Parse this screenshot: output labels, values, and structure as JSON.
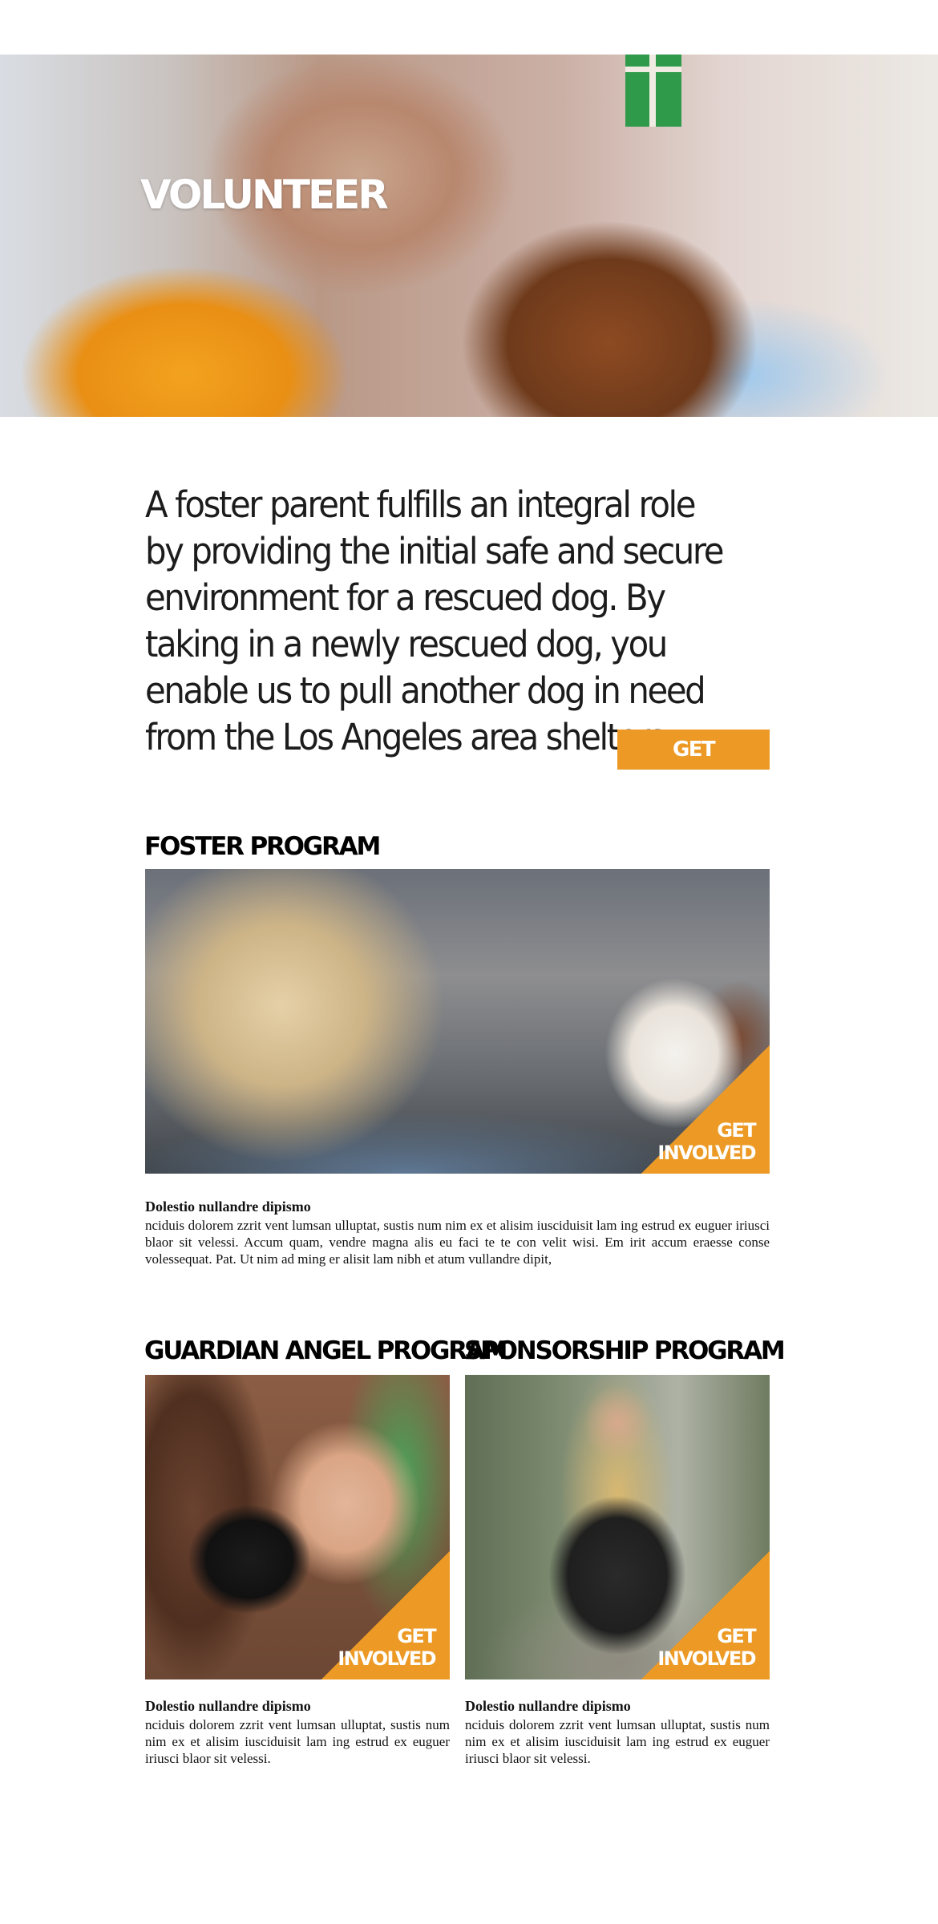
{
  "hero": {
    "title": "VOLUNTEER"
  },
  "intro": {
    "text": "A foster parent fulfills an integral role by providing the initial safe and secure environment for a rescued dog. By taking in a newly rescued dog, you enable us to pull another dog in need from the Los Angeles area shelters.",
    "button_label": "GET INVOLVED"
  },
  "programs": {
    "foster": {
      "heading": "FOSTER PROGRAM",
      "tag_label": "GET\nINVOLVED",
      "card_title": "Dolestio nullandre dipismo",
      "card_text": "nciduis dolorem zzrit vent lumsan ulluptat, sustis num nim ex et alisim iusciduisit lam ing estrud ex euguer iriusci blaor sit velessi. Accum quam, vendre magna alis eu faci te te con velit wisi. Em irit accum eraesse conse volessequat. Pat. Ut nim ad ming er alisit lam nibh et atum vullandre dipit,"
    },
    "guardian": {
      "heading": "GUARDIAN ANGEL PROGRAM",
      "tag_label": "GET\nINVOLVED",
      "card_title": "Dolestio nullandre dipismo",
      "card_text": "nciduis dolorem zzrit vent lumsan ulluptat, sustis num nim ex et alisim iusciduisit lam ing estrud ex euguer iriusci blaor sit velessi."
    },
    "sponsorship": {
      "heading": "SPONSORSHIP PROGRAM",
      "tag_label": "GET\nINVOLVED",
      "card_title": "Dolestio nullandre dipismo",
      "card_text": "nciduis dolorem zzrit vent lumsan ulluptat, sustis num nim ex et alisim iusciduisit lam ing estrud ex euguer iriusci blaor sit velessi."
    }
  },
  "colors": {
    "accent": "#ec9a25",
    "text": "#111111",
    "background": "#ffffff"
  }
}
